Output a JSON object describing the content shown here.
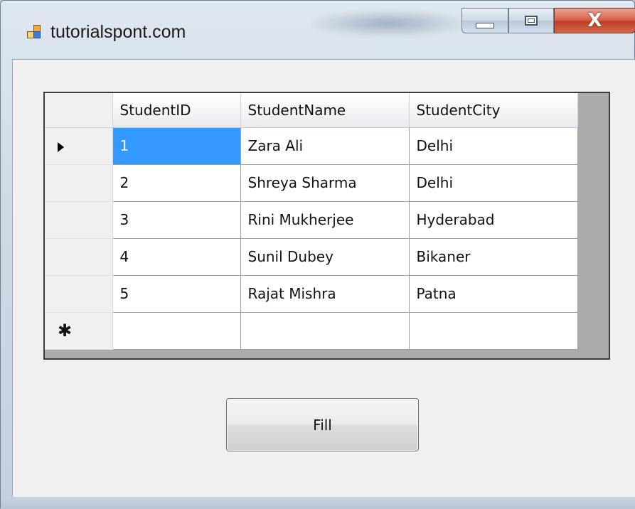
{
  "window": {
    "title": "tutorialspont.com",
    "icon": "winforms-app-icon",
    "caption_buttons": {
      "minimize": "minimize-icon",
      "maximize": "maximize-icon",
      "close_label": "X"
    }
  },
  "grid": {
    "columns": [
      "StudentID",
      "StudentName",
      "StudentCity"
    ],
    "rows": [
      {
        "id": "1",
        "name": "Zara Ali",
        "city": "Delhi"
      },
      {
        "id": "2",
        "name": "Shreya Sharma",
        "city": "Delhi"
      },
      {
        "id": "3",
        "name": "Rini Mukherjee",
        "city": "Hyderabad"
      },
      {
        "id": "4",
        "name": "Sunil Dubey",
        "city": "Bikaner"
      },
      {
        "id": "5",
        "name": "Rajat Mishra",
        "city": "Patna"
      }
    ],
    "new_row_marker": "✱",
    "selection_color": "#3399ff"
  },
  "fill_button": {
    "label": "Fill"
  }
}
